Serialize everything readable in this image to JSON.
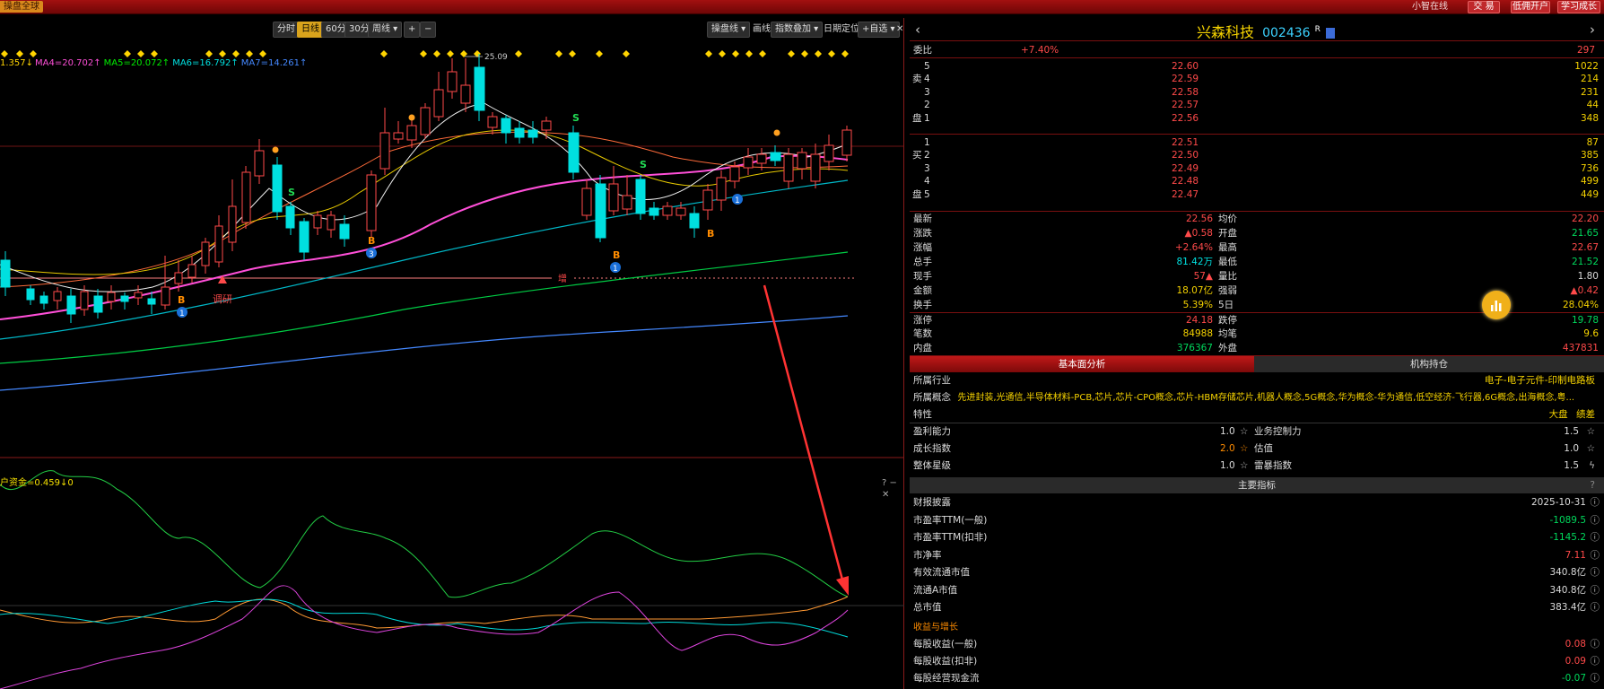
{
  "topbar": {
    "left_label": "操盘全球",
    "online": "小智在线",
    "buttons": [
      "交 易",
      "低佣开户",
      "学习成长"
    ]
  },
  "chart": {
    "periods": [
      "分时",
      "日线",
      "60分",
      "30分",
      "周线 ▾"
    ],
    "active_period": "日线",
    "zoom_buttons": [
      "+",
      "−"
    ],
    "tools": [
      "操盘线 ▾",
      "画线",
      "指数叠加 ▾",
      "日期定位",
      "+自选 ▾"
    ],
    "ma_legend": [
      {
        "text": "1.357↓",
        "color": "#ffd400"
      },
      {
        "text": "MA4=20.702↑",
        "color": "#ff4fd8"
      },
      {
        "text": "MA5=20.072↑",
        "color": "#00ee00"
      },
      {
        "text": "MA6=16.792↑",
        "color": "#00e0e0"
      },
      {
        "text": "MA7=14.261↑",
        "color": "#4488ff"
      }
    ],
    "high_label": "25.09",
    "markers": {
      "diaoyan": "调研",
      "zeng": "增",
      "B": "B",
      "S": "S",
      "n1": "1",
      "n3": "3"
    },
    "indicator": {
      "label": "户资金=0.459↓0",
      "controls": "? − ✕"
    }
  },
  "stock": {
    "name": "兴森科技",
    "code": "002436",
    "suffix": "R",
    "weibi_label": "委比",
    "weibi_value": "+7.40%",
    "weicha_value": "297",
    "asks": [
      {
        "level": "5",
        "price": "22.60",
        "vol": "1022"
      },
      {
        "level": "4",
        "price": "22.59",
        "vol": "214"
      },
      {
        "level": "3",
        "price": "22.58",
        "vol": "231"
      },
      {
        "level": "2",
        "price": "22.57",
        "vol": "44"
      },
      {
        "level": "1",
        "price": "22.56",
        "vol": "348"
      }
    ],
    "bids": [
      {
        "level": "1",
        "price": "22.51",
        "vol": "87"
      },
      {
        "level": "2",
        "price": "22.50",
        "vol": "385"
      },
      {
        "level": "3",
        "price": "22.49",
        "vol": "736"
      },
      {
        "level": "4",
        "price": "22.48",
        "vol": "499"
      },
      {
        "level": "5",
        "price": "22.47",
        "vol": "449"
      }
    ],
    "ask_side_chars": [
      "卖",
      "盘"
    ],
    "bid_side_chars": [
      "买",
      "盘"
    ],
    "quote": [
      {
        "l1": "最新",
        "v1": "22.56",
        "c1": "red",
        "l2": "均价",
        "v2": "22.20",
        "c2": "red"
      },
      {
        "l1": "涨跌",
        "v1": "▲0.58",
        "c1": "red",
        "l2": "开盘",
        "v2": "21.65",
        "c2": "green"
      },
      {
        "l1": "涨幅",
        "v1": "+2.64%",
        "c1": "red",
        "l2": "最高",
        "v2": "22.67",
        "c2": "red"
      },
      {
        "l1": "总手",
        "v1": "81.42万",
        "c1": "cyan",
        "l2": "最低",
        "v2": "21.52",
        "c2": "green"
      },
      {
        "l1": "现手",
        "v1": "57▲",
        "c1": "red",
        "l2": "量比",
        "v2": "1.80",
        "c2": "white"
      },
      {
        "l1": "金额",
        "v1": "18.07亿",
        "c1": "yellow",
        "l2": "强弱",
        "v2": "▲0.42",
        "c2": "red"
      },
      {
        "l1": "换手",
        "v1": "5.39%",
        "c1": "yellow",
        "l2": "5日",
        "v2": "28.04%",
        "c2": "yellow"
      },
      {
        "l1": "涨停",
        "v1": "24.18",
        "c1": "red",
        "l2": "跌停",
        "v2": "19.78",
        "c2": "green"
      },
      {
        "l1": "笔数",
        "v1": "84988",
        "c1": "yellow",
        "l2": "均笔",
        "v2": "9.6",
        "c2": "yellow"
      },
      {
        "l1": "内盘",
        "v1": "376367",
        "c1": "green",
        "l2": "外盘",
        "v2": "437831",
        "c2": "red"
      }
    ],
    "tabs": [
      "基本面分析",
      "机构持仓"
    ],
    "industry_label": "所属行业",
    "industry_value": "电子-电子元件-印制电路板",
    "concept_label": "所属概念",
    "concept_value": "先进封装,光通信,半导体材料-PCB,芯片,芯片-CPO概念,芯片-HBM存储芯片,机器人概念,5G概念,华为概念-华为通信,低空经济-飞行器,6G概念,出海概念,粤...",
    "trait_label": "特性",
    "traits": [
      "大盘",
      "绩差"
    ],
    "ratings": [
      {
        "l1": "盈利能力",
        "v1": "1.0",
        "l2": "业务控制力",
        "v2": "1.5"
      },
      {
        "l1": "成长指数",
        "v1": "2.0",
        "l2": "估值",
        "v2": "1.0"
      },
      {
        "l1": "整体星级",
        "v1": "1.0",
        "l2": "雷暴指数",
        "v2": "1.5"
      }
    ],
    "main_title": "主要指标",
    "indicators": [
      {
        "label": "财报披露",
        "value": "2025-10-31",
        "color": "white"
      },
      {
        "label": "市盈率TTM(一般)",
        "value": "-1089.5",
        "color": "green"
      },
      {
        "label": "市盈率TTM(扣非)",
        "value": "-1145.2",
        "color": "green"
      },
      {
        "label": "市净率",
        "value": "7.11",
        "color": "red"
      },
      {
        "label": "有效流通市值",
        "value": "340.8亿",
        "color": "white"
      },
      {
        "label": "流通A市值",
        "value": "340.8亿",
        "color": "white"
      },
      {
        "label": "总市值",
        "value": "383.4亿",
        "color": "white"
      }
    ],
    "growth_title": "收益与增长",
    "growth": [
      {
        "label": "每股收益(一般)",
        "value": "0.08",
        "color": "red"
      },
      {
        "label": "每股收益(扣非)",
        "value": "0.09",
        "color": "red"
      },
      {
        "label": "每股经营现金流",
        "value": "-0.07",
        "color": "green"
      }
    ]
  },
  "colors": {
    "up": "#ff4a4a",
    "down": "#00e0e0",
    "accent": "#f6d300",
    "panel_red": "#7a1010"
  }
}
